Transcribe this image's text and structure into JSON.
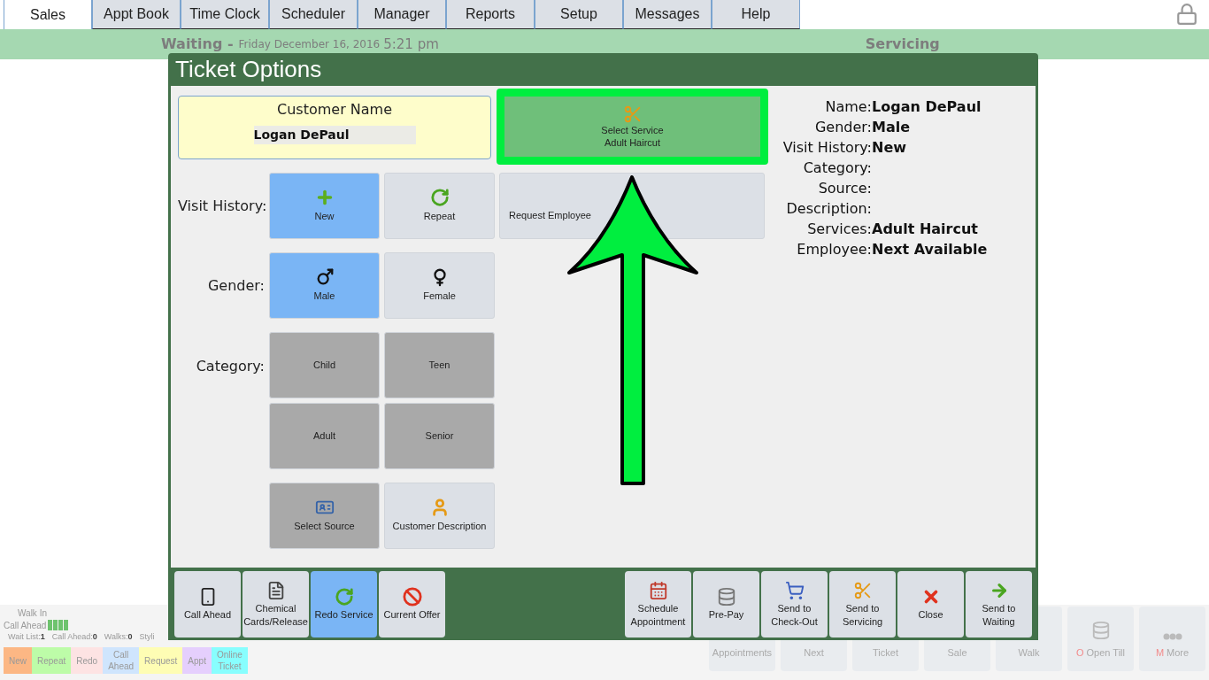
{
  "tabs": [
    {
      "label": "Sales",
      "selected": true
    },
    {
      "label": "Appt Book",
      "selected": false
    },
    {
      "label": "Time Clock",
      "selected": false
    },
    {
      "label": "Scheduler",
      "selected": false
    },
    {
      "label": "Manager",
      "selected": false
    },
    {
      "label": "Reports",
      "selected": false
    },
    {
      "label": "Setup",
      "selected": false
    },
    {
      "label": "Messages",
      "selected": false
    },
    {
      "label": "Help",
      "selected": false
    }
  ],
  "status_bar": {
    "waiting": "Waiting -",
    "date": "Friday December 16, 2016",
    "time": "5:21 pm",
    "servicing": "Servicing"
  },
  "queue_panel": {
    "walk_in": "Walk In",
    "call_ahead": "Call Ahead",
    "stats": [
      {
        "label": "Wait List:",
        "value": "1"
      },
      {
        "label": "Call Ahead:",
        "value": "0"
      },
      {
        "label": "Walks:",
        "value": "0"
      },
      {
        "label": "Styli"
      }
    ],
    "legend": [
      {
        "label": "New",
        "color": "#fcb784"
      },
      {
        "label": "Repeat",
        "color": "#bdfca8"
      },
      {
        "label": "Redo",
        "color": "#fde3e3"
      },
      {
        "label": "Call Ahead",
        "color": "#cfe5fd"
      },
      {
        "label": "Request",
        "color": "#fefdb4"
      },
      {
        "label": "Appt",
        "color": "#e5cffd"
      },
      {
        "label": "Online Ticket",
        "color": "#88fefe"
      }
    ]
  },
  "bottom_buttons": [
    {
      "label": "Appointments"
    },
    {
      "label": "Next"
    },
    {
      "label": "Ticket"
    },
    {
      "label": "Sale"
    },
    {
      "label": "Walk"
    },
    {
      "key": "O",
      "label": "Open Till"
    },
    {
      "key": "M",
      "label": "More"
    }
  ],
  "dialog": {
    "title": "Ticket Options",
    "customer": {
      "label": "Customer Name",
      "value": "Logan DePaul"
    },
    "select_service": {
      "label": "Select Service",
      "value": "Adult Haircut",
      "highlighted": true
    },
    "visit_history": {
      "label": "Visit History:",
      "options": [
        {
          "label": "New",
          "selected": true
        },
        {
          "label": "Repeat",
          "selected": false
        }
      ],
      "request_employee": "Request Employee"
    },
    "gender": {
      "label": "Gender:",
      "options": [
        {
          "label": "Male",
          "selected": true
        },
        {
          "label": "Female",
          "selected": false
        }
      ]
    },
    "category": {
      "label": "Category:",
      "options": [
        {
          "label": "Child",
          "selected": false
        },
        {
          "label": "Teen",
          "selected": false
        },
        {
          "label": "Adult",
          "selected": false
        },
        {
          "label": "Senior",
          "selected": false
        }
      ]
    },
    "extras": [
      {
        "label": "Select Source",
        "kind": "dark"
      },
      {
        "label": "Customer Description",
        "kind": "light"
      }
    ],
    "summary": [
      {
        "label": "Name:",
        "value": "Logan DePaul"
      },
      {
        "label": "Gender:",
        "value": "Male"
      },
      {
        "label": "Visit History:",
        "value": "New"
      },
      {
        "label": "Category:"
      },
      {
        "label": "Source:"
      },
      {
        "label": "Description:"
      },
      {
        "label": "Services:",
        "value": "Adult Haircut"
      },
      {
        "label": "Employee:",
        "value": "Next Available"
      }
    ],
    "footer_left": [
      {
        "label": "Call Ahead",
        "selected": false
      },
      {
        "label": "Chemical Cards/Release",
        "selected": false
      },
      {
        "label": "Redo Service",
        "selected": true
      },
      {
        "label": "Current Offer",
        "selected": false
      }
    ],
    "footer_right": [
      {
        "label": "Schedule Appointment"
      },
      {
        "label": "Pre-Pay"
      },
      {
        "label": "Send to Check-Out"
      },
      {
        "label": "Send to Servicing"
      },
      {
        "label": "Close"
      },
      {
        "label": "Send to Waiting"
      }
    ]
  },
  "annotation": {
    "arrow": true
  }
}
